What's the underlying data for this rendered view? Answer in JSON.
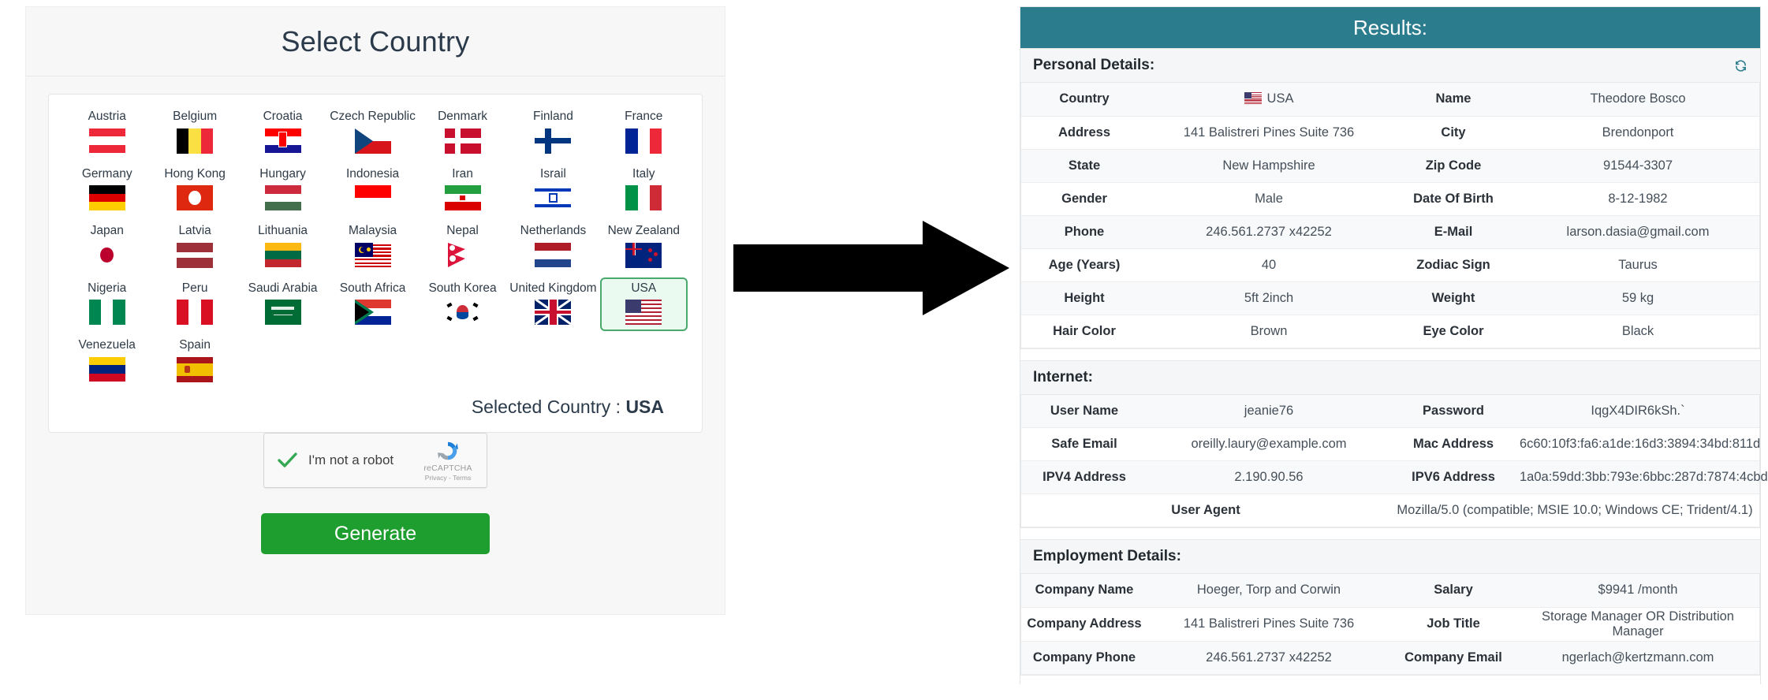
{
  "left": {
    "title": "Select Country",
    "selected_label": "Selected Country :",
    "selected_country": "USA",
    "countries": [
      {
        "name": "Austria",
        "code": "at"
      },
      {
        "name": "Belgium",
        "code": "be"
      },
      {
        "name": "Croatia",
        "code": "hr"
      },
      {
        "name": "Czech Republic",
        "code": "cz"
      },
      {
        "name": "Denmark",
        "code": "dk"
      },
      {
        "name": "Finland",
        "code": "fi"
      },
      {
        "name": "France",
        "code": "fr"
      },
      {
        "name": "Germany",
        "code": "de"
      },
      {
        "name": "Hong Kong",
        "code": "hk"
      },
      {
        "name": "Hungary",
        "code": "hu"
      },
      {
        "name": "Indonesia",
        "code": "id"
      },
      {
        "name": "Iran",
        "code": "ir"
      },
      {
        "name": "Israil",
        "code": "il"
      },
      {
        "name": "Italy",
        "code": "it"
      },
      {
        "name": "Japan",
        "code": "jp"
      },
      {
        "name": "Latvia",
        "code": "lv"
      },
      {
        "name": "Lithuania",
        "code": "lt"
      },
      {
        "name": "Malaysia",
        "code": "my"
      },
      {
        "name": "Nepal",
        "code": "np"
      },
      {
        "name": "Netherlands",
        "code": "nl"
      },
      {
        "name": "New Zealand",
        "code": "nz"
      },
      {
        "name": "Nigeria",
        "code": "ng"
      },
      {
        "name": "Peru",
        "code": "pe"
      },
      {
        "name": "Saudi Arabia",
        "code": "sa"
      },
      {
        "name": "South Africa",
        "code": "za"
      },
      {
        "name": "South Korea",
        "code": "kr"
      },
      {
        "name": "United Kingdom",
        "code": "gb"
      },
      {
        "name": "USA",
        "code": "us",
        "selected": true
      },
      {
        "name": "Venezuela",
        "code": "ve"
      },
      {
        "name": "Spain",
        "code": "es"
      }
    ],
    "captcha": {
      "label": "I'm not a robot",
      "brand": "reCAPTCHA",
      "terms": "Privacy - Terms",
      "checked": true
    },
    "generate_label": "Generate"
  },
  "right": {
    "header": "Results:",
    "sections": [
      {
        "title": "Personal Details:",
        "has_refresh": true,
        "rows": [
          {
            "k1": "Country",
            "v1": "USA",
            "flag": "us",
            "k2": "Name",
            "v2": "Theodore Bosco"
          },
          {
            "k1": "Address",
            "v1": "141 Balistreri Pines Suite 736",
            "k2": "City",
            "v2": "Brendonport"
          },
          {
            "k1": "State",
            "v1": "New Hampshire",
            "k2": "Zip Code",
            "v2": "91544-3307"
          },
          {
            "k1": "Gender",
            "v1": "Male",
            "k2": "Date Of Birth",
            "v2": "8-12-1982"
          },
          {
            "k1": "Phone",
            "v1": "246.561.2737 x42252",
            "k2": "E-Mail",
            "v2": "larson.dasia@gmail.com"
          },
          {
            "k1": "Age (Years)",
            "v1": "40",
            "k2": "Zodiac Sign",
            "v2": "Taurus"
          },
          {
            "k1": "Height",
            "v1": "5ft 2inch",
            "k2": "Weight",
            "v2": "59 kg"
          },
          {
            "k1": "Hair Color",
            "v1": "Brown",
            "k2": "Eye Color",
            "v2": "Black"
          }
        ]
      },
      {
        "title": "Internet:",
        "has_refresh": false,
        "rows": [
          {
            "k1": "User Name",
            "v1": "jeanie76",
            "k2": "Password",
            "v2": "IqgX4DIR6kSh.`"
          },
          {
            "k1": "Safe Email",
            "v1": "oreilly.laury@example.com",
            "k2": "Mac Address",
            "v2": "6c60:10f3:fa6:a1de:16d3:3894:34bd:811d"
          },
          {
            "k1": "IPV4 Address",
            "v1": "2.190.90.56",
            "k2": "IPV6 Address",
            "v2": "1a0a:59dd:3bb:793e:6bbc:287d:7874:4cbd"
          }
        ],
        "wide_row": {
          "k": "User Agent",
          "v": "Mozilla/5.0 (compatible; MSIE 10.0; Windows CE; Trident/4.1)"
        }
      },
      {
        "title": "Employment Details:",
        "has_refresh": false,
        "rows": [
          {
            "k1": "Company Name",
            "v1": "Hoeger, Torp and Corwin",
            "k2": "Salary",
            "v2": "$9941 /month"
          },
          {
            "k1": "Company Address",
            "v1": "141 Balistreri Pines Suite 736",
            "k2": "Job Title",
            "v2": "Storage Manager OR Distribution Manager"
          },
          {
            "k1": "Company Phone",
            "v1": "246.561.2737 x42252",
            "k2": "Company Email",
            "v2": "ngerlach@kertzmann.com"
          }
        ]
      }
    ]
  },
  "colors": {
    "header_teal": "#2b7c8c",
    "generate_green": "#1e9e2e",
    "selected_border": "#4aa96c"
  }
}
